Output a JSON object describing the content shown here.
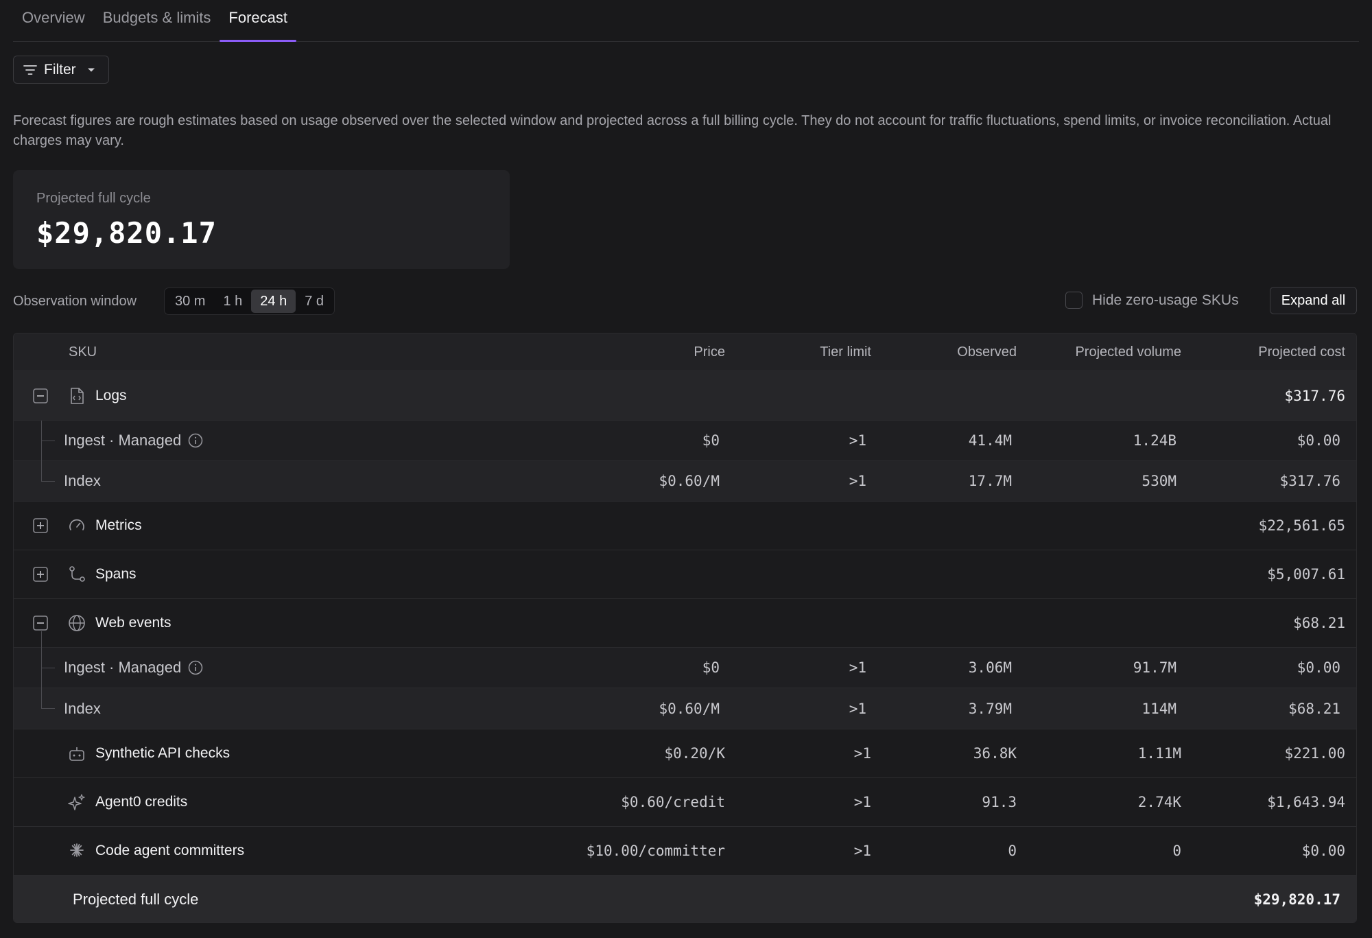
{
  "tabs": [
    {
      "label": "Overview"
    },
    {
      "label": "Budgets & limits"
    },
    {
      "label": "Forecast"
    }
  ],
  "filter": {
    "label": "Filter"
  },
  "description": "Forecast figures are rough estimates based on usage observed over the selected window and projected across a full billing cycle. They do not account for traffic fluctuations, spend limits, or invoice reconciliation. Actual charges may vary.",
  "card": {
    "label": "Projected full cycle",
    "value": "$29,820.17"
  },
  "observation": {
    "label": "Observation window",
    "options": [
      "30 m",
      "1 h",
      "24 h",
      "7 d"
    ],
    "selected": "24 h"
  },
  "hide_zero": {
    "label": "Hide zero-usage SKUs",
    "checked": false
  },
  "expand_all": {
    "label": "Expand all"
  },
  "table": {
    "headers": {
      "sku": "SKU",
      "price": "Price",
      "tier": "Tier limit",
      "observed": "Observed",
      "volume": "Projected volume",
      "cost": "Projected cost"
    },
    "logs": {
      "name": "Logs",
      "icon": "log-file-icon",
      "cost": "$317.76",
      "children": [
        {
          "name": "Ingest · Managed",
          "price": "$0",
          "tier": ">1",
          "observed": "41.4M",
          "volume": "1.24B",
          "cost": "$0.00"
        },
        {
          "name": "Index",
          "price": "$0.60/M",
          "tier": ">1",
          "observed": "17.7M",
          "volume": "530M",
          "cost": "$317.76"
        }
      ]
    },
    "metrics": {
      "name": "Metrics",
      "icon": "gauge-icon",
      "cost": "$22,561.65"
    },
    "spans": {
      "name": "Spans",
      "icon": "route-icon",
      "cost": "$5,007.61"
    },
    "web_events": {
      "name": "Web events",
      "icon": "globe-icon",
      "cost": "$68.21",
      "children": [
        {
          "name": "Ingest · Managed",
          "price": "$0",
          "tier": ">1",
          "observed": "3.06M",
          "volume": "91.7M",
          "cost": "$0.00"
        },
        {
          "name": "Index",
          "price": "$0.60/M",
          "tier": ">1",
          "observed": "3.79M",
          "volume": "114M",
          "cost": "$68.21"
        }
      ]
    },
    "synthetic": {
      "name": "Synthetic API checks",
      "icon": "robot-icon",
      "price": "$0.20/K",
      "tier": ">1",
      "observed": "36.8K",
      "volume": "1.11M",
      "cost": "$221.00"
    },
    "agent": {
      "name": "Agent0 credits",
      "icon": "sparkle-icon",
      "price": "$0.60/credit",
      "tier": ">1",
      "observed": "91.3",
      "volume": "2.74K",
      "cost": "$1,643.94"
    },
    "code_agent": {
      "name": "Code agent committers",
      "icon": "burst-icon",
      "price": "$10.00/committer",
      "tier": ">1",
      "observed": "0",
      "volume": "0",
      "cost": "$0.00"
    },
    "total": {
      "label": "Projected full cycle",
      "cost": "$29,820.17"
    }
  }
}
